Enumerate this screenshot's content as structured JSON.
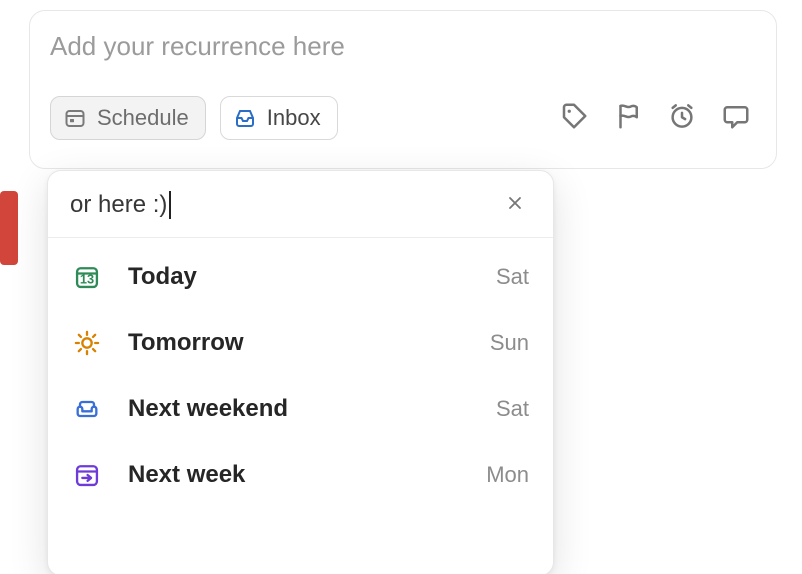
{
  "task": {
    "placeholder": "Add your recurrence here"
  },
  "toolbar": {
    "schedule_label": "Schedule",
    "inbox_label": "Inbox"
  },
  "popover": {
    "search_value": "or here :)",
    "options": [
      {
        "id": "today",
        "label": "Today",
        "meta": "Sat",
        "icon": "calendar-13-icon",
        "color": "#2e8b57"
      },
      {
        "id": "tomorrow",
        "label": "Tomorrow",
        "meta": "Sun",
        "icon": "sun-icon",
        "color": "#d98200"
      },
      {
        "id": "next-weekend",
        "label": "Next weekend",
        "meta": "Sat",
        "icon": "sofa-icon",
        "color": "#3b6fd8"
      },
      {
        "id": "next-week",
        "label": "Next week",
        "meta": "Mon",
        "icon": "arrow-box-icon",
        "color": "#6f3bd8"
      }
    ]
  }
}
